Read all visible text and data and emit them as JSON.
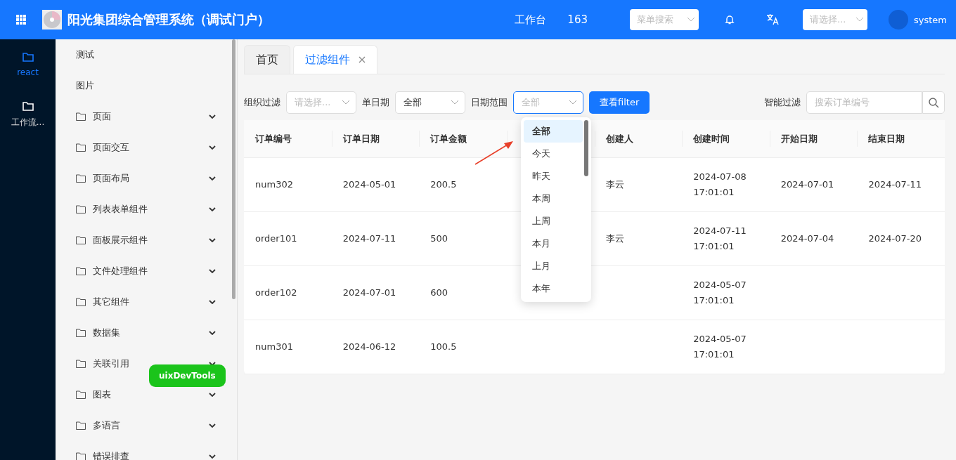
{
  "header": {
    "title": "阳光集团综合管理系统（调试门户）",
    "links": [
      "工作台",
      "163"
    ],
    "menu_search": {
      "placeholder": "菜单搜索"
    },
    "select": {
      "placeholder": "请选择..."
    },
    "user": "system"
  },
  "rail": [
    {
      "label": "react",
      "selected": true
    },
    {
      "label": "工作流...",
      "selected": false
    }
  ],
  "sidebar": {
    "items": [
      {
        "label": "测试",
        "kind": "leaf"
      },
      {
        "label": "图片",
        "kind": "leaf"
      },
      {
        "label": "页面",
        "kind": "folder"
      },
      {
        "label": "页面交互",
        "kind": "folder"
      },
      {
        "label": "页面布局",
        "kind": "folder"
      },
      {
        "label": "列表表单组件",
        "kind": "folder"
      },
      {
        "label": "面板展示组件",
        "kind": "folder"
      },
      {
        "label": "文件处理组件",
        "kind": "folder"
      },
      {
        "label": "其它组件",
        "kind": "folder"
      },
      {
        "label": "数据集",
        "kind": "folder"
      },
      {
        "label": "关联引用",
        "kind": "folder"
      },
      {
        "label": "图表",
        "kind": "folder"
      },
      {
        "label": "多语言",
        "kind": "folder"
      },
      {
        "label": "错误排查",
        "kind": "folder"
      }
    ]
  },
  "tabs": [
    {
      "label": "首页",
      "selected": false,
      "closable": false
    },
    {
      "label": "过滤组件",
      "selected": true,
      "closable": true
    }
  ],
  "filters": [
    {
      "label": "组织过滤",
      "placeholder": "请选择..."
    },
    {
      "label": "单日期",
      "value": "全部"
    },
    {
      "label": "日期范围",
      "placeholder": "全部",
      "focused": true
    }
  ],
  "query_button": "查看filter",
  "smart_filter": {
    "label": "智能过滤",
    "placeholder": "搜索订单编号"
  },
  "table": {
    "columns": [
      {
        "label": "订单编号"
      },
      {
        "label": "订单日期"
      },
      {
        "label": "订单金额"
      },
      {
        "covered": true
      },
      {
        "label": "创建人"
      },
      {
        "label": "创建时间"
      },
      {
        "label": "开始日期"
      },
      {
        "label": "结束日期"
      }
    ],
    "rows": [
      [
        "num302",
        "2024-05-01",
        "200.5",
        null,
        "李云",
        "2024-07-08 17:01:01",
        "2024-07-01",
        "2024-07-11"
      ],
      [
        "order101",
        "2024-07-11",
        "500",
        null,
        "李云",
        "2024-07-11 17:01:01",
        "2024-07-04",
        "2024-07-20"
      ],
      [
        "order102",
        "2024-07-01",
        "600",
        null,
        null,
        "2024-05-07 17:01:01",
        null,
        null
      ],
      [
        "num301",
        "2024-06-12",
        "100.5",
        null,
        null,
        "2024-05-07 17:01:01",
        null,
        null
      ]
    ]
  },
  "dropdown": {
    "options": [
      {
        "label": "全部",
        "selected": true
      },
      {
        "label": "今天",
        "selected": false
      },
      {
        "label": "昨天",
        "selected": false
      },
      {
        "label": "本周",
        "selected": false
      },
      {
        "label": "上周",
        "selected": false
      },
      {
        "label": "本月",
        "selected": false
      },
      {
        "label": "上月",
        "selected": false
      },
      {
        "label": "本年",
        "selected": false
      }
    ]
  },
  "devtools_button": "uixDevTools"
}
